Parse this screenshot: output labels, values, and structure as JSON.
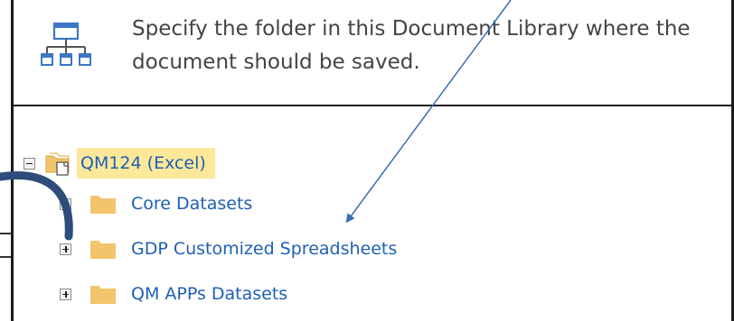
{
  "header": {
    "icon": "hierarchy-icon",
    "instruction": "Specify the folder in this Document Library where the document should be saved."
  },
  "tree": {
    "root": {
      "label": "QM124 (Excel)",
      "expanded": true,
      "icon": "workbook-folder-icon",
      "expander": "collapse-icon"
    },
    "children": [
      {
        "label": "Core Datasets",
        "icon": "folder-icon",
        "expander": "expand-icon"
      },
      {
        "label": "GDP Customized Spreadsheets",
        "icon": "folder-icon",
        "expander": "expand-icon"
      },
      {
        "label": "QM APPs Datasets",
        "icon": "folder-icon",
        "expander": "expand-icon"
      }
    ]
  },
  "colors": {
    "link": "#1f5fb3",
    "highlight": "#fde89a",
    "folder": "#f2c56b",
    "annotation_arrow": "#3a6fb0",
    "curved_arrow": "#2e4d7a"
  }
}
